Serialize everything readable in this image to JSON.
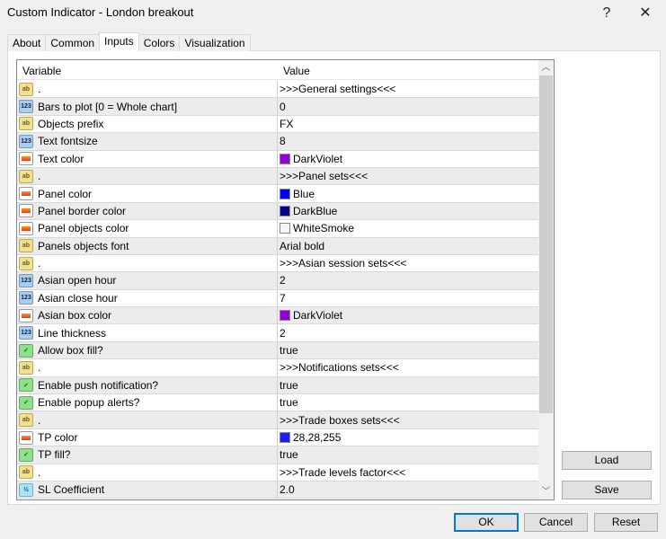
{
  "window": {
    "title": "Custom Indicator - London breakout",
    "help": "?",
    "close": "✕"
  },
  "tabs": [
    "About",
    "Common",
    "Inputs",
    "Colors",
    "Visualization"
  ],
  "active_tab": "Inputs",
  "table": {
    "headers": [
      "Variable",
      "Value"
    ],
    "rows": [
      {
        "type": "string",
        "icon": "ab",
        "variable": ".",
        "value": ">>>General settings<<<"
      },
      {
        "type": "int",
        "icon": "123",
        "variable": "Bars to plot [0 = Whole chart]",
        "value": "0"
      },
      {
        "type": "string",
        "icon": "ab",
        "variable": "Objects prefix",
        "value": "FX"
      },
      {
        "type": "int",
        "icon": "123",
        "variable": "Text fontsize",
        "value": "8"
      },
      {
        "type": "color",
        "variable": "Text color",
        "value": "DarkViolet",
        "swatch": "#9400d3"
      },
      {
        "type": "string",
        "icon": "ab",
        "variable": ".",
        "value": ">>>Panel sets<<<"
      },
      {
        "type": "color",
        "variable": "Panel color",
        "value": "Blue",
        "swatch": "#0000ff"
      },
      {
        "type": "color",
        "variable": "Panel border color",
        "value": "DarkBlue",
        "swatch": "#00008b"
      },
      {
        "type": "color",
        "variable": "Panel objects color",
        "value": "WhiteSmoke",
        "swatch": "#f5f5f5"
      },
      {
        "type": "string",
        "icon": "ab",
        "variable": "Panels objects font",
        "value": "Arial bold"
      },
      {
        "type": "string",
        "icon": "ab",
        "variable": ".",
        "value": ">>>Asian session sets<<<"
      },
      {
        "type": "int",
        "icon": "123",
        "variable": "Asian open hour",
        "value": "2"
      },
      {
        "type": "int",
        "icon": "123",
        "variable": "Asian close hour",
        "value": "7"
      },
      {
        "type": "color",
        "variable": "Asian box color",
        "value": "DarkViolet",
        "swatch": "#9400d3"
      },
      {
        "type": "int",
        "icon": "123",
        "variable": "Line thickness",
        "value": "2"
      },
      {
        "type": "bool",
        "icon": "✓",
        "variable": "Allow box fill?",
        "value": "true"
      },
      {
        "type": "string",
        "icon": "ab",
        "variable": ".",
        "value": ">>>Notifications sets<<<"
      },
      {
        "type": "bool",
        "icon": "✓",
        "variable": "Enable push notification?",
        "value": "true"
      },
      {
        "type": "bool",
        "icon": "✓",
        "variable": "Enable popup alerts?",
        "value": "true"
      },
      {
        "type": "string",
        "icon": "ab",
        "variable": ".",
        "value": ">>>Trade boxes sets<<<"
      },
      {
        "type": "color",
        "variable": "TP color",
        "value": "28,28,255",
        "swatch": "#1c1cff"
      },
      {
        "type": "bool",
        "icon": "✓",
        "variable": "TP fill?",
        "value": "true"
      },
      {
        "type": "string",
        "icon": "ab",
        "variable": ".",
        "value": ">>>Trade levels factor<<<"
      },
      {
        "type": "double",
        "icon": "½",
        "variable": "SL Coefficient",
        "value": "2.0"
      }
    ]
  },
  "buttons": {
    "load": "Load",
    "save": "Save",
    "ok": "OK",
    "cancel": "Cancel",
    "reset": "Reset"
  }
}
